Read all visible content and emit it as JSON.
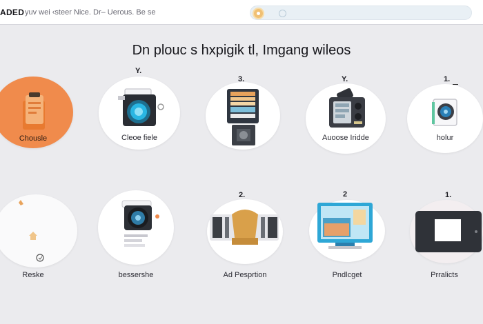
{
  "app": {
    "brand": "ADED",
    "crumb": "yuv wei ‹steer Nice. Dr–  Uerous.  Be se",
    "search_placeholder": ""
  },
  "headline": "Dn plouc s hxpigik tl,  Imgang wileos",
  "row1": [
    {
      "mark": "",
      "label": "Chousle"
    },
    {
      "mark": "Y.",
      "label": "Cleoe fiele"
    },
    {
      "mark": "3.",
      "label": ""
    },
    {
      "mark": "Y.",
      "label": "Auoose  Iridde"
    },
    {
      "mark": "1.",
      "label": "holur"
    }
  ],
  "row2": [
    {
      "mark": "",
      "label": "Reske"
    },
    {
      "mark": "",
      "label": "bessershe"
    },
    {
      "mark": "2.",
      "label": "Ad Pesprtion"
    },
    {
      "mark": "2",
      "label": "Pndlcget"
    },
    {
      "mark": "1.",
      "label": "Prralicts"
    }
  ],
  "colors": {
    "accent_orange": "#f08b4c",
    "background": "#ebebee",
    "camera_blue": "#21a3d3"
  }
}
